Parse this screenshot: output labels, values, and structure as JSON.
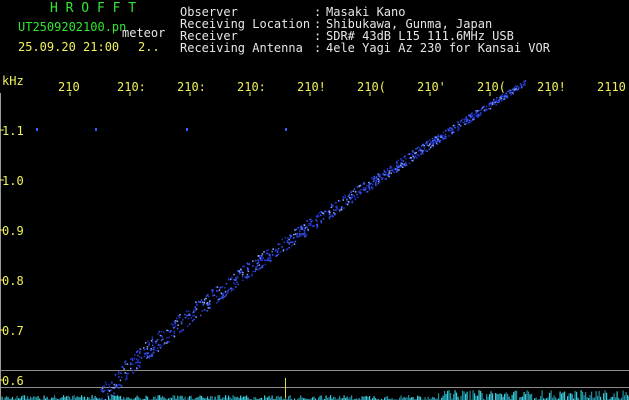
{
  "header": {
    "app_title": "H R O F F T",
    "filename": "UT2509202100.pn",
    "mode": "meteor",
    "datetime": "25.09.20 21:00",
    "page": "2..",
    "fields": [
      {
        "label": "Observer",
        "value": "Masaki Kano"
      },
      {
        "label": "Receiving Location",
        "value": "Shibukawa, Gunma, Japan"
      },
      {
        "label": "Receiver",
        "value": "SDR# 43dB L15 111.6MHz USB"
      },
      {
        "label": "Receiving Antenna",
        "value": "4ele Yagi Az 230 for Kansai VOR"
      }
    ],
    "separator": ":"
  },
  "axes": {
    "y_unit": "kHz",
    "y_ticks": [
      "1.1",
      "1.0",
      "0.9",
      "0.8",
      "0.7",
      "0.6"
    ],
    "x_ticks": [
      "210",
      "210:",
      "210:",
      "210:",
      "210!",
      "210(",
      "210'",
      "210(",
      "210!",
      "2110"
    ]
  },
  "colors": {
    "background": "#000000",
    "header_green": "#33e633",
    "header_white": "#e6e6e6",
    "tick_yellow": "#f2f25a",
    "echo_blue": "#3b5cff",
    "noise_cyan": "#38c8d8"
  }
}
